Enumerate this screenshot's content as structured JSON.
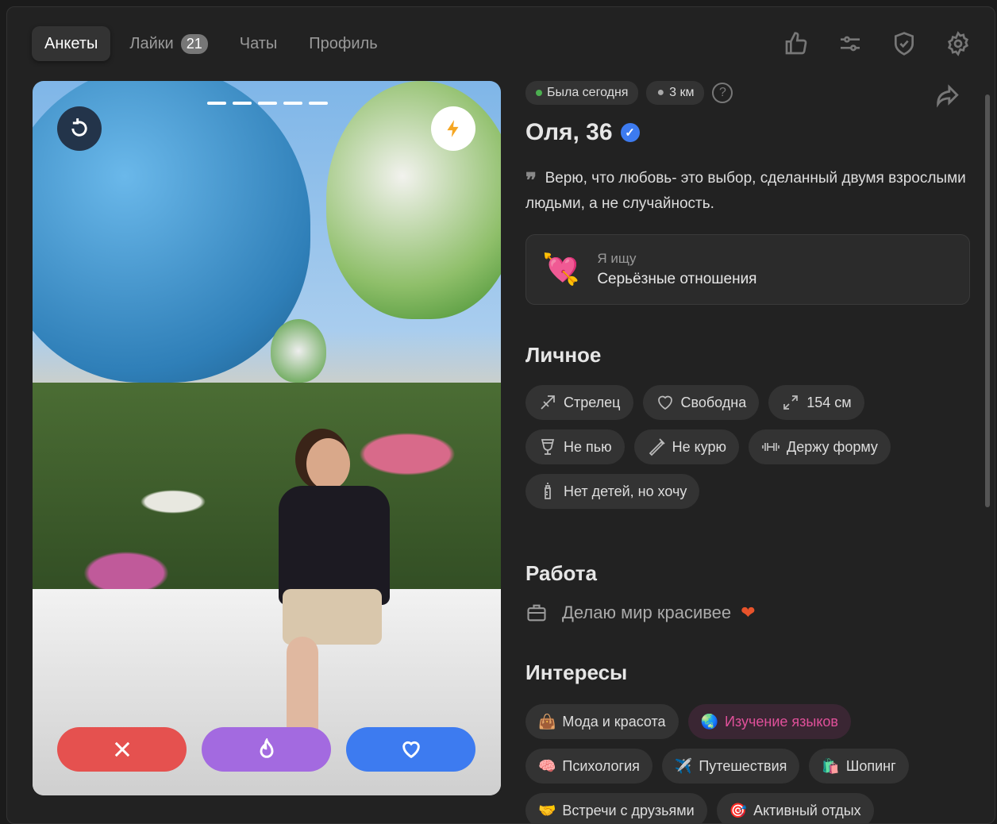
{
  "tabs": [
    {
      "label": "Анкеты"
    },
    {
      "label": "Лайки",
      "badge": "21"
    },
    {
      "label": "Чаты"
    },
    {
      "label": "Профиль"
    }
  ],
  "profile": {
    "status": "Была сегодня",
    "distance": "3 км",
    "name": "Оля, 36",
    "quote": "Верю, что любовь- это выбор, сделанный двумя взрослыми людьми, а не случайность.",
    "seeking_label": "Я ищу",
    "seeking_value": "Серьёзные отношения"
  },
  "personal": {
    "title": "Личное",
    "items": [
      "Стрелец",
      "Свободна",
      "154 см",
      "Не пью",
      "Не курю",
      "Держу форму",
      "Нет детей, но хочу"
    ]
  },
  "work": {
    "title": "Работа",
    "value": "Делаю мир красивее"
  },
  "interests": {
    "title": "Интересы",
    "items": [
      {
        "emoji": "👜",
        "label": "Мода и красота"
      },
      {
        "emoji": "🌏",
        "label": "Изучение языков",
        "highlight": true
      },
      {
        "emoji": "🧠",
        "label": "Психология"
      },
      {
        "emoji": "✈️",
        "label": "Путешествия"
      },
      {
        "emoji": "🛍️",
        "label": "Шопинг"
      },
      {
        "emoji": "🤝",
        "label": "Встречи с друзьями"
      },
      {
        "emoji": "🎯",
        "label": "Активный отдых"
      }
    ]
  },
  "colors": {
    "dislike": "#e5514f",
    "superlike": "#a36ae0",
    "like": "#3d7bf0",
    "online": "#4caf50",
    "verified": "#3d7bf0",
    "highlight_text": "#e0509a"
  }
}
